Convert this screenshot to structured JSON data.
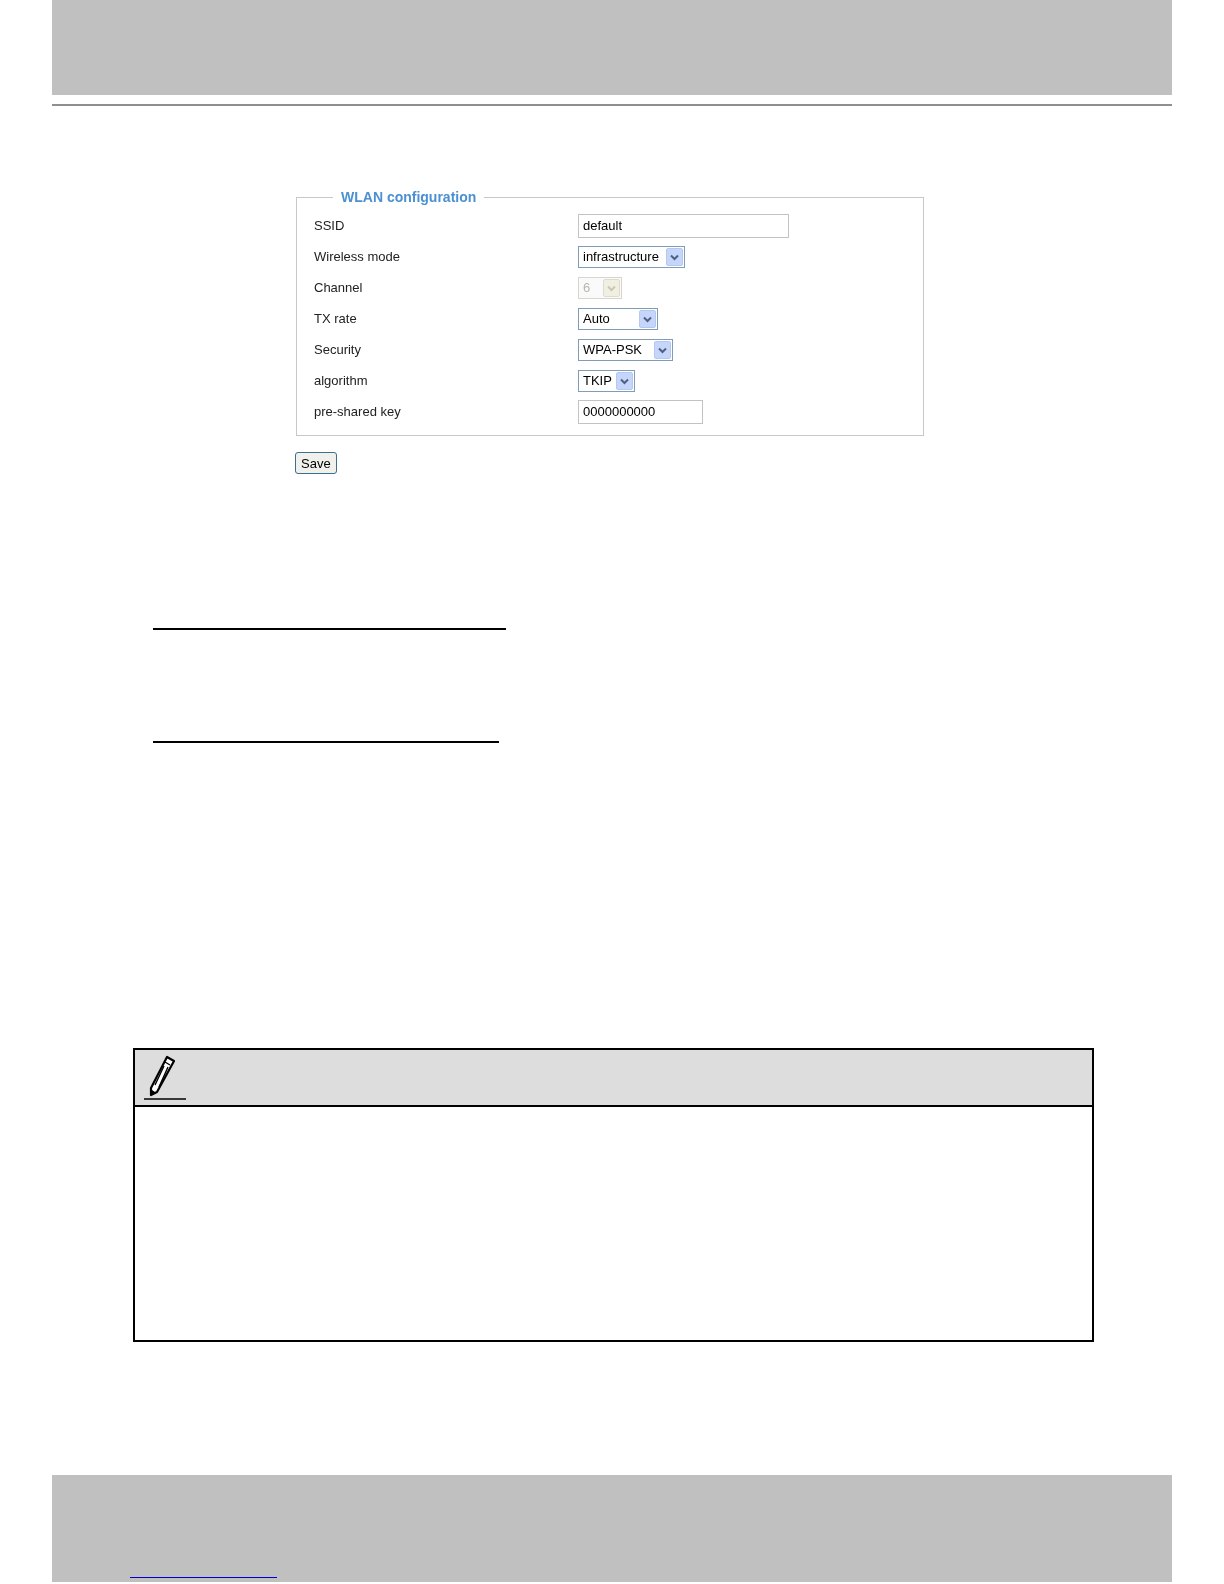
{
  "wlan": {
    "legend": "WLAN configuration",
    "fields": [
      {
        "label": "SSID",
        "kind": "text",
        "value": "default",
        "disabled": false
      },
      {
        "label": "Wireless mode",
        "kind": "select",
        "value": "infrastructure",
        "disabled": false
      },
      {
        "label": "Channel",
        "kind": "select",
        "value": "6",
        "disabled": true
      },
      {
        "label": "TX rate",
        "kind": "select",
        "value": "Auto",
        "disabled": false
      },
      {
        "label": "Security",
        "kind": "select",
        "value": "WPA-PSK",
        "disabled": false
      },
      {
        "label": "algorithm",
        "kind": "select",
        "value": "TKIP",
        "disabled": false
      },
      {
        "label": "pre-shared key",
        "kind": "text",
        "value": "0000000000",
        "disabled": false
      }
    ]
  },
  "save_button": "Save"
}
